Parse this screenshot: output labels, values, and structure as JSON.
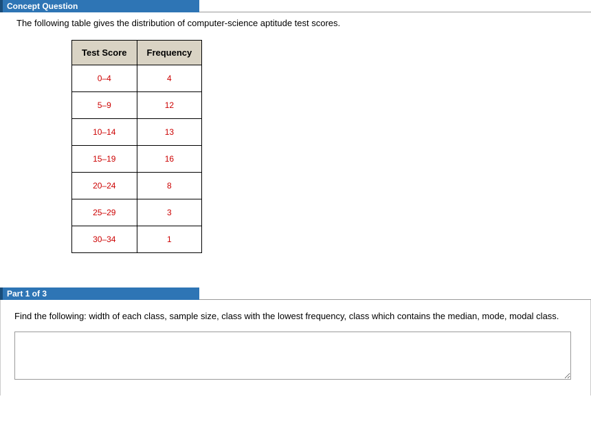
{
  "header1": "Concept Question",
  "intro": "The following table gives the distribution of computer-science aptitude test scores.",
  "table": {
    "headers": [
      "Test Score",
      "Frequency"
    ],
    "rows": [
      [
        "0–4",
        "4"
      ],
      [
        "5–9",
        "12"
      ],
      [
        "10–14",
        "13"
      ],
      [
        "15–19",
        "16"
      ],
      [
        "20–24",
        "8"
      ],
      [
        "25–29",
        "3"
      ],
      [
        "30–34",
        "1"
      ]
    ]
  },
  "header2": "Part 1 of 3",
  "question": "Find the following: width of each class, sample size, class with the lowest frequency, class which contains the median, mode, modal class.",
  "chart_data": {
    "type": "table",
    "title": "Distribution of computer-science aptitude test scores",
    "columns": [
      "Test Score",
      "Frequency"
    ],
    "rows": [
      {
        "Test Score": "0–4",
        "Frequency": 4
      },
      {
        "Test Score": "5–9",
        "Frequency": 12
      },
      {
        "Test Score": "10–14",
        "Frequency": 13
      },
      {
        "Test Score": "15–19",
        "Frequency": 16
      },
      {
        "Test Score": "20–24",
        "Frequency": 8
      },
      {
        "Test Score": "25–29",
        "Frequency": 3
      },
      {
        "Test Score": "30–34",
        "Frequency": 1
      }
    ]
  }
}
